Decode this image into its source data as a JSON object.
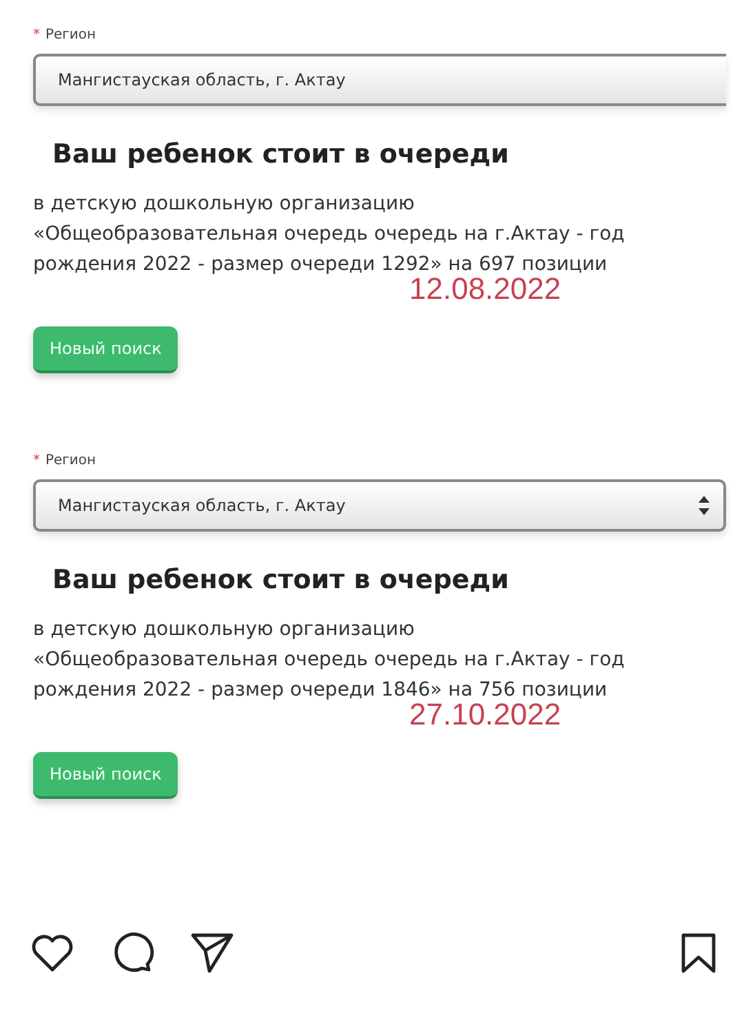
{
  "screenshots": [
    {
      "field_label": "Регион",
      "required": true,
      "required_mark": "*",
      "select_value": "Мангистауская область, г. Актау",
      "select_arrows": false,
      "heading": "Ваш ребенок стоит в очереди",
      "message": "в детскую дошкольную организацию «Общеобразовательная очередь очередь на г.Актау - год рождения 2022 - размер очереди 1292» на 697 позиции",
      "date": "12.08.2022",
      "button": "Новый поиск"
    },
    {
      "field_label": "Регион",
      "required": true,
      "required_mark": "*",
      "select_value": "Мангистауская область, г. Актау",
      "select_arrows": true,
      "heading": "Ваш ребенок стоит в очереди",
      "message": "в детскую дошкольную организацию «Общеобразовательная очередь очередь на г.Актау - год рождения 2022 - размер очереди 1846» на 756 позиции",
      "date": "27.10.2022",
      "button": "Новый поиск"
    }
  ],
  "actions": [
    {
      "kind": "like"
    },
    {
      "kind": "comment"
    },
    {
      "kind": "share"
    },
    {
      "kind": "save"
    }
  ]
}
